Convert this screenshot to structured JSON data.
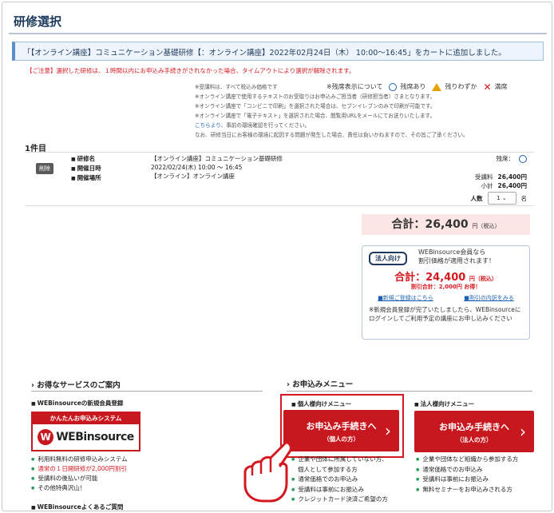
{
  "page": {
    "title": "研修選択",
    "notice": "「【オンライン講座】コミュニケーション基礎研修【：オンライン講座】2022年02月24日（木） 10:00〜16:45」をカートに追加しました。",
    "warning": "【ご注意】選択した研修は、１時間以内にお申込み手続きがされなかった場合、タイムアウトにより選択が解除されます。"
  },
  "notes": {
    "lines": [
      "※受講料は、すべて税込み価格です",
      "※オンライン講座で使用するテキストのお受取りはお申込みご担当者（研修担当者）さまとなります。",
      "※オンライン講座で「コンビニで印刷」を選択された場合は、セブンイレブンのみで印刷が可能です。",
      "※オンライン講座で「電子テキスト」を選択された場合、閲覧用URLをメールにてお送りいたします。"
    ],
    "link": "こちらより",
    "link_suffix": "、事前の環境確認を行ってください。",
    "last": "なお、研修当日にお客様の環境に起因する問題が発生した場合、責任は負いかねますので、その旨ご了承ください。",
    "legend": {
      "label": "※残席表示について",
      "available": "残席あり",
      "few": "残りわずか",
      "full": "満席"
    }
  },
  "cart": {
    "count": "1件目",
    "delete_label": "削除",
    "keys": [
      "研修名",
      "開催日時",
      "開催場所"
    ],
    "values": [
      "【オンライン講座】コミュニケーション基礎研修",
      "2022/02/24(木) 10:00 〜 16:45",
      "【オンライン】オンライン講座"
    ],
    "seat_label": "残席：",
    "fee_label": "受講料",
    "fee_value": "26,400円",
    "subtotal_label": "小計",
    "subtotal_value": "26,400円",
    "people_label": "人数",
    "people_value": "1",
    "people_unit": "名"
  },
  "total": {
    "label": "合計：26,400",
    "unit": "円（税込）"
  },
  "corporate": {
    "tag": "法人向け",
    "msg1": "WEBinsource会員なら",
    "msg2": "割引価格が適用されます！",
    "total": "合計：24,400",
    "total_unit": "円（税込）",
    "discount": "割引合計：2,000円 お得！",
    "link1": "■新規ご登録はこちら",
    "link2": "■割引の内訳をみる",
    "note": "※新規会員登録が完了いたしましたら、WEBinsourceにログインしてご利用予定の講座にお申し込みください"
  },
  "services": {
    "heading": "お得なサービスのご案内",
    "sub1": "WEBinsourceの新規会員登録",
    "banner_top": "かんたんお申込みシステム",
    "banner_logo": "WEBinsource",
    "bullets": [
      "利用料無料の研修申込みシステム",
      "通常の１日開研修が2,000円割引",
      "受講料の後払いが可能",
      "その他特典沢山！"
    ],
    "sub2": "WEBinsourceよくあるご質問"
  },
  "menu": {
    "heading": "お申込みメニュー",
    "personal_sub": "個人様向けメニュー",
    "corp_sub": "法人様向けメニュー",
    "personal_btn1": "お申込み手続きへ",
    "personal_btn2": "（個人の方）",
    "corp_btn1": "お申込み手続きへ",
    "corp_btn2": "（法人の方）",
    "personal_bullets": [
      "企業や団体に所属していない方、",
      "個人として参加する方",
      "通常価格でのお申込み",
      "受講料は事前にお振込み",
      "クレジットカード決済ご希望の方"
    ],
    "corp_bullets": [
      "企業や団体など組織から参加する方",
      "通常価格でのお申込み",
      "受講料は事前にお振込み",
      "無料セミナーをお申込みされる方"
    ]
  },
  "colors": {
    "brand_red": "#c8181f",
    "navy": "#1d3a5c",
    "link_blue": "#1c5fb0",
    "bullet_green": "#2a9d5c"
  }
}
